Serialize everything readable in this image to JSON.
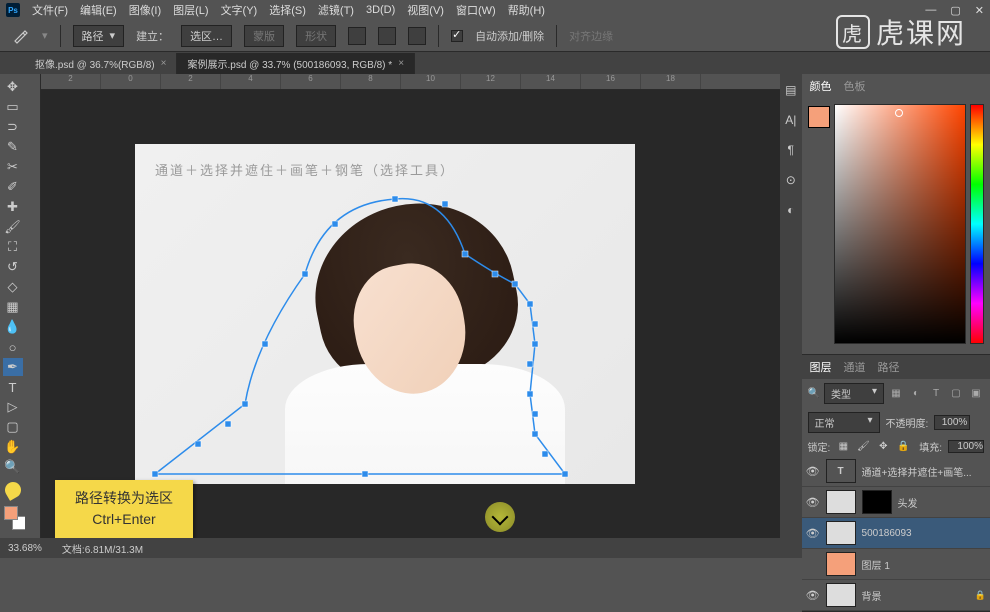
{
  "menu": {
    "items": [
      "文件(F)",
      "编辑(E)",
      "图像(I)",
      "图层(L)",
      "文字(Y)",
      "选择(S)",
      "滤镜(T)",
      "3D(D)",
      "视图(V)",
      "窗口(W)",
      "帮助(H)"
    ]
  },
  "optbar": {
    "mode": "路径",
    "make": "建立：",
    "sel": "选区…",
    "mask": "蒙版",
    "shape": "形状",
    "auto": "自动添加/删除",
    "align": "对齐边缘"
  },
  "tabs": [
    {
      "label": "抠像.psd @ 36.7%(RGB/8)",
      "active": false
    },
    {
      "label": "案例展示.psd @ 33.7% (500186093, RGB/8) *",
      "active": true
    }
  ],
  "ruler": [
    "2",
    "0",
    "2",
    "4",
    "6",
    "8",
    "10",
    "12",
    "14",
    "16",
    "18"
  ],
  "doc_text": "通道＋选择并遮住＋画笔＋钢笔（选择工具）",
  "tooltip": {
    "l1": "路径转换为选区",
    "l2": "Ctrl+Enter"
  },
  "color_panel": {
    "tabs": [
      "颜色",
      "色板"
    ]
  },
  "layers_panel": {
    "tabs": [
      "图层",
      "通道",
      "路径"
    ],
    "kind": "类型",
    "blend": "正常",
    "opacity_lbl": "不透明度:",
    "opacity": "100%",
    "lock_lbl": "锁定:",
    "fill_lbl": "填充:",
    "fill": "100%",
    "items": [
      {
        "eye": "👁",
        "type": "T",
        "name": "通道+选择并遮住+画笔..."
      },
      {
        "eye": "👁",
        "type": "img_mask",
        "name": "头发"
      },
      {
        "eye": "👁",
        "type": "img",
        "name": "500186093",
        "sel": true
      },
      {
        "eye": "",
        "type": "solid",
        "name": "图层 1"
      },
      {
        "eye": "👁",
        "type": "bg",
        "name": "背景",
        "lock": "🔒"
      }
    ]
  },
  "status": {
    "zoom": "33.68%",
    "doc": "文档:6.81M/31.3M"
  },
  "watermark": "虎课网"
}
